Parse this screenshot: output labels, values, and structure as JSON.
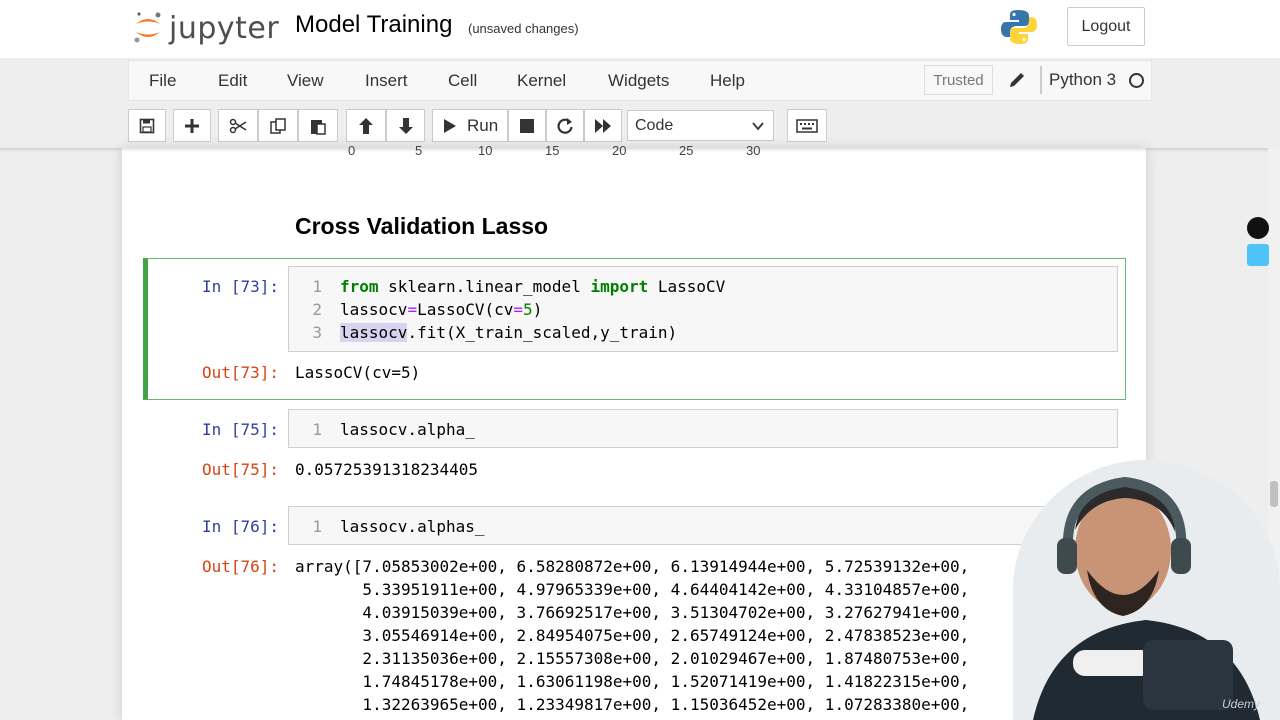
{
  "header": {
    "logo_text": "jupyter",
    "notebook_name": "Model Training",
    "save_status": "(unsaved changes)",
    "logout_label": "Logout"
  },
  "menubar": {
    "items": [
      "File",
      "Edit",
      "View",
      "Insert",
      "Cell",
      "Kernel",
      "Widgets",
      "Help"
    ],
    "trusted_label": "Trusted",
    "kernel_name": "Python 3"
  },
  "toolbar": {
    "run_label": "Run",
    "cell_type": "Code"
  },
  "plot_axis_ticks": [
    "0",
    "5",
    "10",
    "15",
    "20",
    "25",
    "30"
  ],
  "section_heading": "Cross Validation Lasso",
  "cells": [
    {
      "in_prompt": "In [73]:",
      "lines": [
        "from sklearn.linear_model import LassoCV",
        "lassocv=LassoCV(cv=5)",
        "lassocv.fit(X_train_scaled,y_train)"
      ],
      "out_prompt": "Out[73]:",
      "output": "LassoCV(cv=5)"
    },
    {
      "in_prompt": "In [75]:",
      "lines": [
        "lassocv.alpha_"
      ],
      "out_prompt": "Out[75]:",
      "output": "0.05725391318234405"
    },
    {
      "in_prompt": "In [76]:",
      "lines": [
        "lassocv.alphas_"
      ],
      "out_prompt": "Out[76]:",
      "output_lines": [
        "array([7.05853002e+00, 6.58280872e+00, 6.13914944e+00, 5.72539132e+00,",
        "       5.33951911e+00, 4.97965339e+00, 4.64404142e+00, 4.33104857e+00,",
        "       4.03915039e+00, 3.76692517e+00, 3.51304702e+00, 3.27627941e+00,",
        "       3.05546914e+00, 2.84954075e+00, 2.65749124e+00, 2.47838523e+00,",
        "       2.31135036e+00, 2.15557308e+00, 2.01029467e+00, 1.87480753e+00,",
        "       1.74845178e+00, 1.63061198e+00, 1.52071419e+00, 1.41822315e+00,",
        "       1.32263965e+00, 1.23349817e+00, 1.15036452e+00, 1.07283380e+00,"
      ]
    }
  ],
  "watermark": "Udemy",
  "colors": {
    "selected_cell_border": "#42a545",
    "in_prompt": "#303f9f",
    "out_prompt": "#d84315",
    "keyword": "#008000"
  }
}
